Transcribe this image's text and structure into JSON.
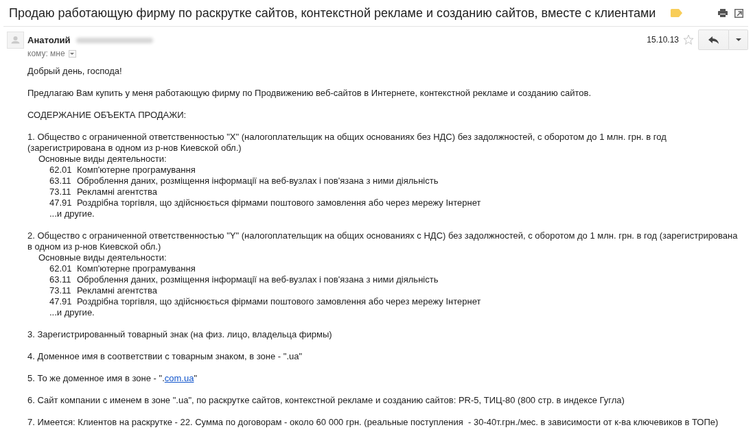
{
  "subject": "Продаю работающую фирму по раскрутке сайтов, контекстной рекламе и созданию сайтов, вместе с клиентами",
  "message": {
    "sender": "Анатолий",
    "recipients": "кому: мне",
    "date": "15.10.13",
    "starred": false,
    "body": [
      {
        "kind": "paragraph",
        "text": "Добрый день, господа!"
      },
      {
        "kind": "paragraph",
        "text": "Предлагаю Вам купить у меня работающую фирму по Продвижению веб-сайтов в Интернете, контекстной рекламе и созданию сайтов."
      },
      {
        "kind": "paragraph",
        "text": "СОДЕРЖАНИЕ ОБЪЕКТА ПРОДАЖИ:"
      },
      {
        "kind": "company",
        "text": "1. Общество с ограниченной ответственностью \"X\" (налогоплательщик на общих основаниях без НДС) без задолжностей, с оборотом до 1 млн. грн. в год (зарегистрирована в одном из р-нов Киевской обл.)",
        "activities_heading": "Основные виды деятельности:",
        "activities": [
          {
            "code": "62.01",
            "name": "Комп'ютерне програмування"
          },
          {
            "code": "63.11",
            "name": "Оброблення даних, розміщення інформації на веб-вузлах і пов'язана з ними діяльність"
          },
          {
            "code": "73.11",
            "name": "Рекламні агентства"
          },
          {
            "code": "47.91",
            "name": "Роздрібна торгівля, що здійснюється фірмами поштового замовлення або через мережу Інтернет"
          }
        ],
        "more": "...и другие."
      },
      {
        "kind": "company",
        "text": "2. Общество с ограниченной ответственностью \"Y\" (налогоплательщик на общих основаниях с НДС) без задолжностей, с оборотом до 1 млн. грн. в год (зарегистрирована в одном из р-нов Киевской обл.)",
        "activities_heading": "Основные виды деятельности:",
        "activities": [
          {
            "code": "62.01",
            "name": "Комп'ютерне програмування"
          },
          {
            "code": "63.11",
            "name": "Оброблення даних, розміщення інформації на веб-вузлах і пов'язана з ними діяльність"
          },
          {
            "code": "73.11",
            "name": "Рекламні агентства"
          },
          {
            "code": "47.91",
            "name": "Роздрібна торгівля, що здійснюється фірмами поштового замовлення або через мережу Інтернет"
          }
        ],
        "more": "...и другие."
      },
      {
        "kind": "paragraph",
        "text": "3. Зарегистрированный товарный знак (на физ. лицо, владельца фирмы)"
      },
      {
        "kind": "paragraph",
        "text": "4. Доменное имя в соответствии с товарным знаком, в зоне - \".ua\""
      },
      {
        "kind": "linked",
        "text": "5. То же доменное имя в зоне - \".",
        "link": "com.ua",
        "text_after": "\""
      },
      {
        "kind": "paragraph",
        "text": "6. Сайт компании с именем в зоне \".ua\", по раскрутке сайтов, контекстной рекламе и созданию сайтов: PR-5, ТИЦ-80 (800 стр. в индексе Гугла)"
      },
      {
        "kind": "paragraph",
        "text": "7. Имеется: Клиентов на раскрутке - 22. Сумма по договорам - около 60 000 грн. (реальные поступления  - 30-40т.грн./мес. в зависимости от к-ва ключевиков в ТОПе)"
      }
    ]
  }
}
